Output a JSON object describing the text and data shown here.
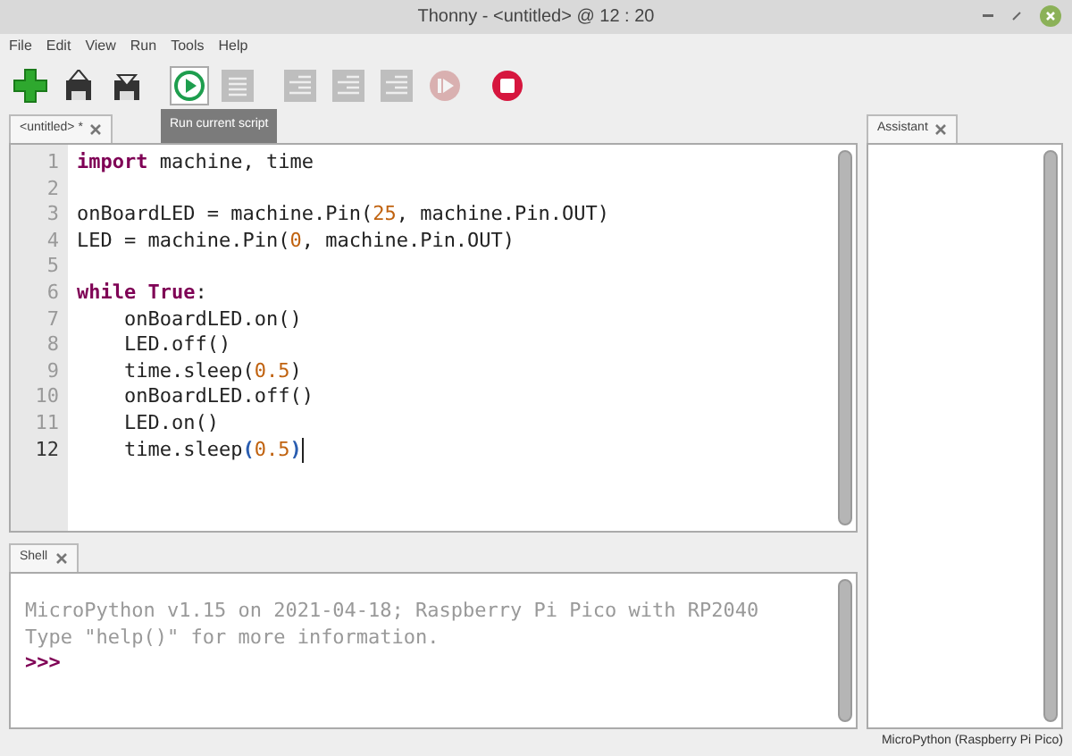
{
  "window": {
    "title": "Thonny - <untitled> @ 12 : 20"
  },
  "menu": [
    "File",
    "Edit",
    "View",
    "Run",
    "Tools",
    "Help"
  ],
  "toolbar": [
    {
      "kind": "new",
      "disabled": false,
      "selected": false
    },
    {
      "kind": "load",
      "disabled": false,
      "selected": false
    },
    {
      "kind": "save",
      "disabled": false,
      "selected": false
    },
    {
      "kind": "run",
      "disabled": false,
      "selected": true
    },
    {
      "kind": "debug",
      "disabled": true,
      "selected": false
    },
    {
      "kind": "step",
      "disabled": true,
      "selected": false
    },
    {
      "kind": "step",
      "disabled": true,
      "selected": false
    },
    {
      "kind": "step",
      "disabled": true,
      "selected": false
    },
    {
      "kind": "resume",
      "disabled": true,
      "selected": false
    },
    {
      "kind": "stop",
      "disabled": false,
      "selected": false
    }
  ],
  "tooltip": "Run current script",
  "editor": {
    "tab": "<untitled> *",
    "lines": [
      {
        "number": "1",
        "current": false,
        "tokens": [
          {
            "kind": "keyword",
            "text": "import"
          },
          {
            "kind": "plain",
            "text": " machine, time"
          }
        ]
      },
      {
        "number": "2",
        "current": false
      },
      {
        "number": "3",
        "current": false,
        "tokens": [
          {
            "kind": "plain",
            "text": "onBoardLED = machine.Pin("
          },
          {
            "kind": "number",
            "text": "25"
          },
          {
            "kind": "plain",
            "text": ", machine.Pin.OUT)"
          }
        ]
      },
      {
        "number": "4",
        "current": false,
        "tokens": [
          {
            "kind": "plain",
            "text": "LED = machine.Pin("
          },
          {
            "kind": "number",
            "text": "0"
          },
          {
            "kind": "plain",
            "text": ", machine.Pin.OUT)"
          }
        ]
      },
      {
        "number": "5",
        "current": false
      },
      {
        "number": "6",
        "current": false,
        "tokens": [
          {
            "kind": "keyword",
            "text": "while"
          },
          {
            "kind": "keyword",
            "text": " True"
          },
          {
            "kind": "plain",
            "text": ":"
          }
        ]
      },
      {
        "number": "7",
        "current": false,
        "tokens": [
          {
            "kind": "plain",
            "text": "    onBoardLED.on()"
          }
        ]
      },
      {
        "number": "8",
        "current": false,
        "tokens": [
          {
            "kind": "plain",
            "text": "    LED.off()"
          }
        ]
      },
      {
        "number": "9",
        "current": false,
        "tokens": [
          {
            "kind": "plain",
            "text": "    time.sleep("
          },
          {
            "kind": "number",
            "text": "0.5"
          },
          {
            "kind": "plain",
            "text": ")"
          }
        ]
      },
      {
        "number": "10",
        "current": false,
        "tokens": [
          {
            "kind": "plain",
            "text": "    onBoardLED.off()"
          }
        ]
      },
      {
        "number": "11",
        "current": false,
        "tokens": [
          {
            "kind": "plain",
            "text": "    LED.on()"
          }
        ]
      },
      {
        "number": "12",
        "current": true,
        "tokens": [
          {
            "kind": "plain",
            "text": "    time.sleep"
          },
          {
            "kind": "bracket",
            "text": "("
          },
          {
            "kind": "number",
            "text": "0.5"
          },
          {
            "kind": "bracket",
            "text": ")"
          }
        ]
      }
    ]
  },
  "shell": {
    "tab": "Shell",
    "output": [
      "MicroPython v1.15 on 2021-04-18; Raspberry Pi Pico with RP2040",
      "Type \"help()\" for more information."
    ],
    "prompt": ">>>"
  },
  "assistant": {
    "tab": "Assistant"
  },
  "status_bar": "MicroPython (Raspberry Pi Pico)"
}
